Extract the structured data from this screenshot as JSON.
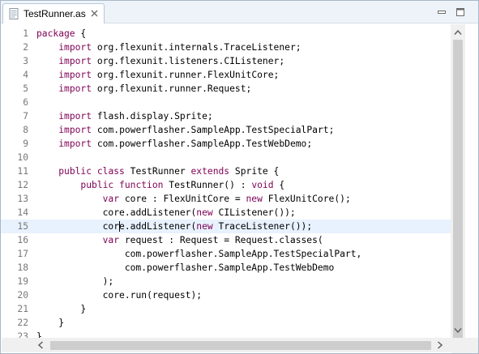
{
  "tab": {
    "title": "TestRunner.as",
    "file_icon": "as-file-icon",
    "close_icon": "close-icon"
  },
  "window_controls": {
    "minimize_icon": "minimize-icon",
    "maximize_icon": "maximize-icon"
  },
  "editor": {
    "current_line": 15,
    "keyword_color": "#7f0055",
    "line_number_color": "#787878",
    "current_line_color": "#e8f2fe",
    "lines": [
      {
        "num": "1",
        "text": "package {"
      },
      {
        "num": "2",
        "text": "    import org.flexunit.internals.TraceListener;"
      },
      {
        "num": "3",
        "text": "    import org.flexunit.listeners.CIListener;"
      },
      {
        "num": "4",
        "text": "    import org.flexunit.runner.FlexUnitCore;"
      },
      {
        "num": "5",
        "text": "    import org.flexunit.runner.Request;"
      },
      {
        "num": "6",
        "text": ""
      },
      {
        "num": "7",
        "text": "    import flash.display.Sprite;"
      },
      {
        "num": "8",
        "text": "    import com.powerflasher.SampleApp.TestSpecialPart;"
      },
      {
        "num": "9",
        "text": "    import com.powerflasher.SampleApp.TestWebDemo;"
      },
      {
        "num": "10",
        "text": ""
      },
      {
        "num": "11",
        "text": "    public class TestRunner extends Sprite {"
      },
      {
        "num": "12",
        "text": "        public function TestRunner() : void {"
      },
      {
        "num": "13",
        "text": "            var core : FlexUnitCore = new FlexUnitCore();"
      },
      {
        "num": "14",
        "text": "            core.addListener(new CIListener());"
      },
      {
        "num": "15",
        "text": "            core.addListener(new TraceListener());"
      },
      {
        "num": "16",
        "text": "            var request : Request = Request.classes("
      },
      {
        "num": "17",
        "text": "                com.powerflasher.SampleApp.TestSpecialPart,"
      },
      {
        "num": "18",
        "text": "                com.powerflasher.SampleApp.TestWebDemo"
      },
      {
        "num": "19",
        "text": "            );"
      },
      {
        "num": "20",
        "text": "            core.run(request);"
      },
      {
        "num": "21",
        "text": "        }"
      },
      {
        "num": "22",
        "text": "    }"
      },
      {
        "num": "23",
        "text": "}"
      }
    ],
    "keywords": [
      "package",
      "import",
      "public",
      "class",
      "extends",
      "function",
      "void",
      "var",
      "new"
    ]
  },
  "scrollbars": {
    "up_icon": "scroll-up-arrow-icon",
    "down_icon": "scroll-down-arrow-icon",
    "left_icon": "scroll-left-arrow-icon",
    "right_icon": "scroll-right-arrow-icon"
  }
}
